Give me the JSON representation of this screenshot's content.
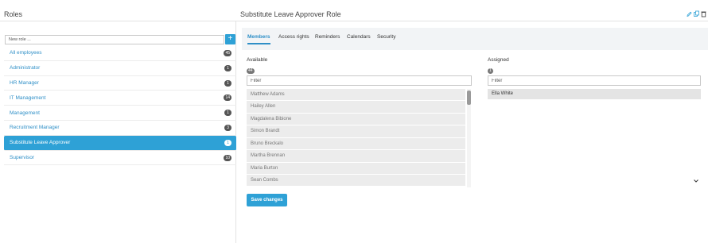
{
  "header": {
    "roles_title": "Roles",
    "role_title": "Substitute Leave Approver Role",
    "icons": [
      "edit-icon",
      "copy-icon",
      "trash-icon"
    ]
  },
  "sidebar": {
    "new_role_placeholder": "New role ...",
    "add_label": "+",
    "items": [
      {
        "label": "All employees",
        "count": "45"
      },
      {
        "label": "Administrator",
        "count": "1"
      },
      {
        "label": "HR Manager",
        "count": "1"
      },
      {
        "label": "IT Management",
        "count": "14"
      },
      {
        "label": "Management",
        "count": "1"
      },
      {
        "label": "Recruitment Manager",
        "count": "3"
      },
      {
        "label": "Substitute Leave Approver",
        "count": "1",
        "active": true
      },
      {
        "label": "Supervisor",
        "count": "10"
      }
    ]
  },
  "tabs": [
    {
      "label": "Members",
      "active": true
    },
    {
      "label": "Access rights"
    },
    {
      "label": "Reminders"
    },
    {
      "label": "Calendars"
    },
    {
      "label": "Security"
    }
  ],
  "available": {
    "label": "Available",
    "count": "44",
    "filter_placeholder": "Filter",
    "items": [
      "Matthew Adams",
      "Hailey Allen",
      "Magdalena Bibione",
      "Simon Brandt",
      "Bruno Breckalo",
      "Martha Brennan",
      "Maria Burton",
      "Sean Combs"
    ]
  },
  "assigned": {
    "label": "Assigned",
    "count": "1",
    "filter_placeholder": "Filter",
    "items": [
      "Ella White"
    ]
  },
  "save_label": "Save changes",
  "colors": {
    "accent": "#2ea1d6",
    "link": "#2e8fc7",
    "badge": "#555555"
  }
}
